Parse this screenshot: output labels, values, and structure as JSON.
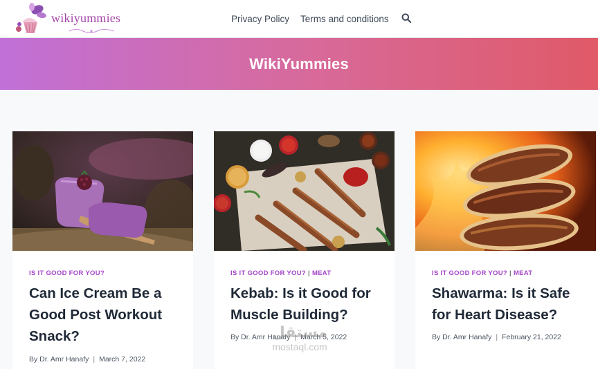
{
  "site": {
    "logo_text": "wikiyummies",
    "nav": [
      {
        "label": "Privacy Policy"
      },
      {
        "label": "Terms and conditions"
      }
    ],
    "search_icon": "search-icon",
    "hero_title": "WikiYummies"
  },
  "posts": [
    {
      "category": "IS IT GOOD FOR YOU?",
      "category2": "",
      "title": "Can Ice Cream Be a Good Post Workout Snack?",
      "author": "By Dr. Amr Hanafy",
      "date": "March 7, 2022"
    },
    {
      "category": "IS IT GOOD FOR YOU?",
      "category2": "MEAT",
      "title": "Kebab: Is it Good for Muscle Building?",
      "author": "By Dr. Amr Hanafy",
      "date": "March 5, 2022"
    },
    {
      "category": "IS IT GOOD FOR YOU?",
      "category2": "MEAT",
      "title": "Shawarma: Is it Safe for Heart Disease?",
      "author": "By Dr. Amr Hanafy",
      "date": "February 21, 2022"
    }
  ],
  "watermark": {
    "arabic": "مستقل",
    "latin": "mostaql.com"
  },
  "colors": {
    "accent": "#a546c8",
    "hero_start": "#c070d8",
    "hero_end": "#e05a68"
  }
}
